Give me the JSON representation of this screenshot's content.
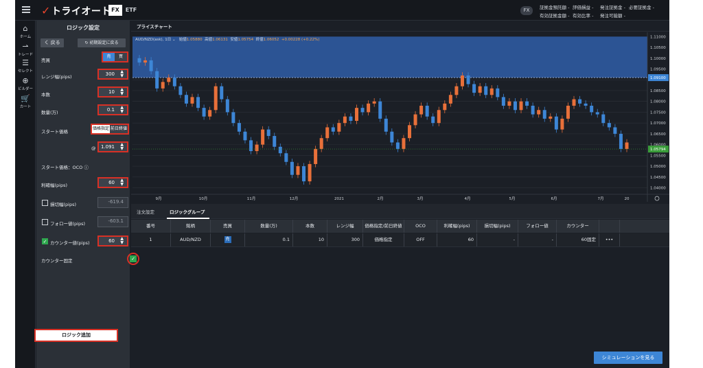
{
  "topbar": {
    "logo": "トライオート",
    "tabs": [
      "FX",
      "ETF"
    ],
    "fx_pill": "FX",
    "account_row1": [
      "証拠金預託額",
      "評価損益",
      "発注証拠金",
      "必要証拠金"
    ],
    "account_row2": [
      "有効証拠金額",
      "有効比率",
      "発注可能額"
    ]
  },
  "nav": [
    {
      "label": "ホーム",
      "icon": "home-icon"
    },
    {
      "label": "トレード",
      "icon": "trade-icon"
    },
    {
      "label": "セレクト",
      "icon": "select-icon"
    },
    {
      "label": "ビルダー",
      "icon": "builder-icon"
    },
    {
      "label": "カート",
      "icon": "cart-icon"
    }
  ],
  "logic": {
    "title": "ロジック設定",
    "back_label": "く 戻る",
    "reset_label": "初期設定に戻る",
    "side_label": "売買",
    "side_options": [
      "売",
      "買"
    ],
    "range_label": "レンジ幅(pips)",
    "range_value": "300",
    "count_label": "本数",
    "count_value": "10",
    "qty_label": "数量(万)",
    "qty_value": "0.1",
    "start_label": "スタート価格",
    "start_options": [
      "価格指定",
      "前日終値"
    ],
    "at_sign": "@",
    "start_value": "1.091",
    "oco_label": "スタート価格：OCO",
    "tp_label": "利確幅(pips)",
    "tp_value": "60",
    "sl_label": "損切幅(pips)",
    "sl_value": "-619.4",
    "follow_label": "フォロー値(pips)",
    "follow_value": "-603.1",
    "counter_label": "カウンター値(pips)",
    "counter_value": "60",
    "counter_fixed_label": "カウンター固定",
    "add_label": "ロジック追加"
  },
  "chart": {
    "tab": "プライスチャート",
    "symbol": "AUD/NZD(ask), 1日",
    "open_label": "始値",
    "open": "1.05880",
    "high_label": "高値",
    "high": "1.06131",
    "low_label": "安値",
    "low": "1.05754",
    "close_label": "終値",
    "close": "1.06052",
    "change": "+0.00228 (+0.22%)",
    "band_marker": "1.09100",
    "last_price": "1.05794"
  },
  "chart_data": {
    "type": "candlestick",
    "y_ticks": [
      "1.11000",
      "1.10500",
      "1.10000",
      "1.09500",
      "1.09000",
      "1.08500",
      "1.08000",
      "1.07500",
      "1.07000",
      "1.06500",
      "1.06000",
      "1.05500",
      "1.05000",
      "1.04500",
      "1.04000"
    ],
    "x_labels": [
      "9月",
      "10月",
      "11月",
      "12月",
      "2021",
      "2月",
      "3月",
      "4月",
      "5月",
      "6月",
      "7月",
      "20"
    ],
    "ylim": [
      1.037,
      1.112
    ],
    "range_band": [
      1.091,
      1.11
    ],
    "closes": [
      1.098,
      1.099,
      1.094,
      1.086,
      1.089,
      1.091,
      1.087,
      1.083,
      1.079,
      1.082,
      1.077,
      1.073,
      1.076,
      1.087,
      1.081,
      1.075,
      1.07,
      1.066,
      1.062,
      1.057,
      1.06,
      1.067,
      1.064,
      1.059,
      1.056,
      1.052,
      1.046,
      1.05,
      1.043,
      1.051,
      1.058,
      1.063,
      1.068,
      1.066,
      1.07,
      1.073,
      1.071,
      1.077,
      1.075,
      1.079,
      1.08,
      1.072,
      1.066,
      1.061,
      1.058,
      1.063,
      1.069,
      1.074,
      1.078,
      1.073,
      1.07,
      1.076,
      1.079,
      1.083,
      1.087,
      1.092,
      1.088,
      1.084,
      1.087,
      1.083,
      1.086,
      1.082,
      1.078,
      1.08,
      1.076,
      1.08,
      1.078,
      1.074,
      1.076,
      1.072,
      1.073,
      1.067,
      1.072,
      1.078,
      1.081,
      1.079,
      1.078,
      1.075,
      1.074,
      1.07,
      1.068,
      1.065,
      1.058,
      1.061
    ],
    "color_up": "#e8703a",
    "color_down": "#3d86d6",
    "band_color": "#2f5ea8"
  },
  "bottom": {
    "tabs": [
      "注文設定",
      "ロジックグループ"
    ],
    "columns": [
      "番号",
      "銘柄",
      "売買",
      "数量(万)",
      "本数",
      "レンジ幅",
      "価格指定/前日終値",
      "OCO",
      "利確幅(pips)",
      "損切幅(pips)",
      "フォロー値",
      "カウンター",
      ""
    ],
    "row": [
      "1",
      "AUD/NZD",
      "売",
      "0.1",
      "10",
      "300",
      "価格指定",
      "OFF",
      "60",
      "-",
      "-",
      "60固定",
      "•••"
    ],
    "simulate_label": "シミュレーションを見る"
  },
  "colors": {
    "accent_red": "#d93025",
    "accent_blue": "#3d86d6",
    "check_green": "#2fa84f"
  }
}
